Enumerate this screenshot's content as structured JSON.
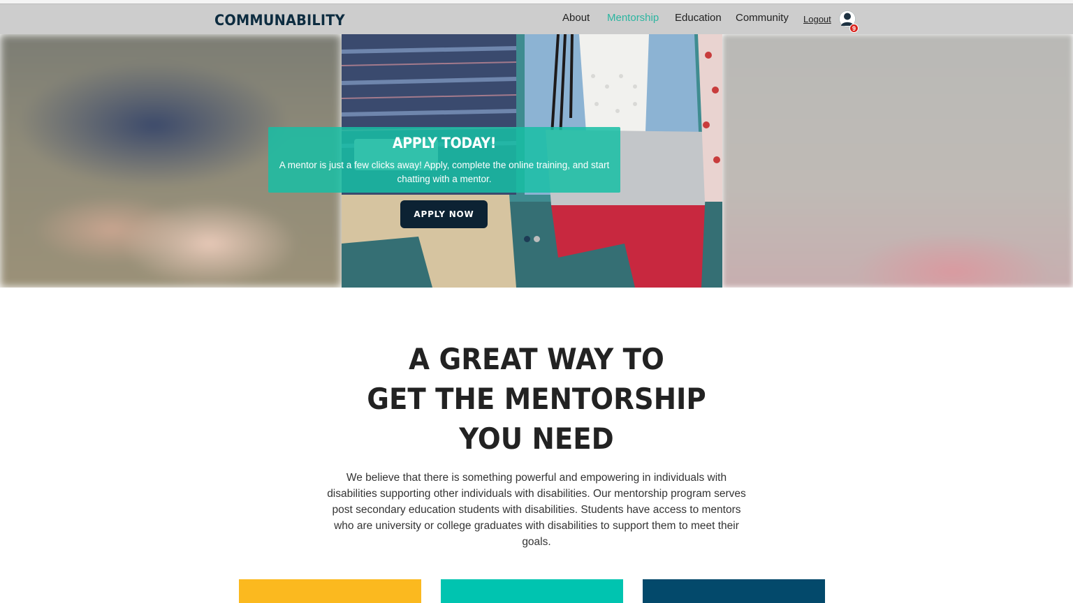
{
  "nav": {
    "brand": "COMMUNABILITY",
    "links": [
      {
        "label": "About",
        "active": false
      },
      {
        "label": "Mentorship",
        "active": true
      },
      {
        "label": "Education",
        "active": false
      },
      {
        "label": "Community",
        "active": false
      }
    ],
    "logout_label": "Logout",
    "notification_count": "9",
    "avatar_icon": "user-avatar-icon"
  },
  "hero": {
    "title": "APPLY TODAY!",
    "text": "A mentor is just a few clicks away! Apply, complete the online training, and start chatting with a mentor.",
    "button_label": "APPLY NOW",
    "slide_count": 2,
    "active_slide": 1
  },
  "intro": {
    "heading_lines": [
      "A GREAT WAY TO",
      "GET THE MENTORSHIP",
      "YOU NEED"
    ],
    "paragraph": "We believe that there is something powerful and empowering in individuals with disabilities supporting other individuals with disabilities. Our mentorship program serves post secondary education students with disabilities. Students have access to mentors who are university or college graduates with disabilities to support them to meet their goals."
  },
  "colors": {
    "brand_navy": "#0d2c40",
    "accent_teal": "#2bb5a0",
    "card_yellow": "#fbb91f",
    "card_teal": "#00c4b0",
    "card_navy": "#03496b"
  }
}
